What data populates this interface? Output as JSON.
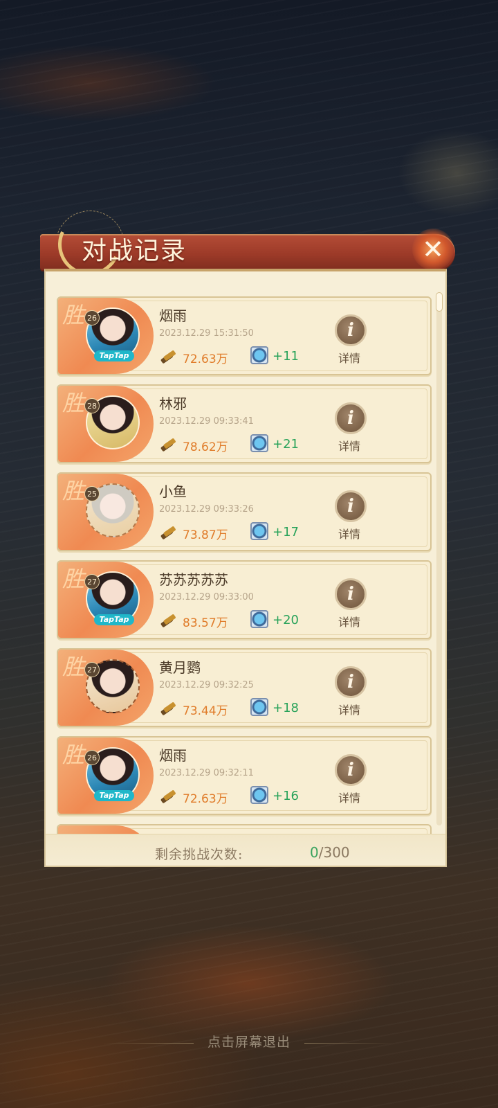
{
  "title": "对战记录",
  "close_icon": "close-icon",
  "records": [
    {
      "result": "胜",
      "level": "26",
      "avatar_badge": "TapTap",
      "name": "烟雨",
      "datetime": "2023.12.29 15:31:50",
      "gold": "72.63万",
      "medal": "+11",
      "detail_label": "详情",
      "detail_icon": "i"
    },
    {
      "result": "胜",
      "level": "28",
      "avatar_badge": "",
      "name": "林邪",
      "datetime": "2023.12.29 09:33:41",
      "gold": "78.62万",
      "medal": "+21",
      "detail_label": "详情",
      "detail_icon": "i"
    },
    {
      "result": "胜",
      "level": "25",
      "avatar_badge": "",
      "name": "小鱼",
      "datetime": "2023.12.29 09:33:26",
      "gold": "73.87万",
      "medal": "+17",
      "detail_label": "详情",
      "detail_icon": "i"
    },
    {
      "result": "胜",
      "level": "27",
      "avatar_badge": "TapTap",
      "name": "苏苏苏苏苏",
      "datetime": "2023.12.29 09:33:00",
      "gold": "83.57万",
      "medal": "+20",
      "detail_label": "详情",
      "detail_icon": "i"
    },
    {
      "result": "胜",
      "level": "27",
      "avatar_badge": "",
      "name": "黄月鹦",
      "datetime": "2023.12.29 09:32:25",
      "gold": "73.44万",
      "medal": "+18",
      "detail_label": "详情",
      "detail_icon": "i"
    },
    {
      "result": "胜",
      "level": "26",
      "avatar_badge": "TapTap",
      "name": "烟雨",
      "datetime": "2023.12.29 09:32:11",
      "gold": "72.63万",
      "medal": "+16",
      "detail_label": "详情",
      "detail_icon": "i"
    }
  ],
  "footer": {
    "remaining_label": "剩余挑战次数:",
    "remaining_current": "0",
    "remaining_sep": "/",
    "remaining_total": "300"
  },
  "exit_hint": "点击屏幕退出",
  "colors": {
    "accent_banner": "#a8412d",
    "gold_text": "#e07c2a",
    "medal_text": "#27a259",
    "panel_bg": "#f7efd8"
  }
}
